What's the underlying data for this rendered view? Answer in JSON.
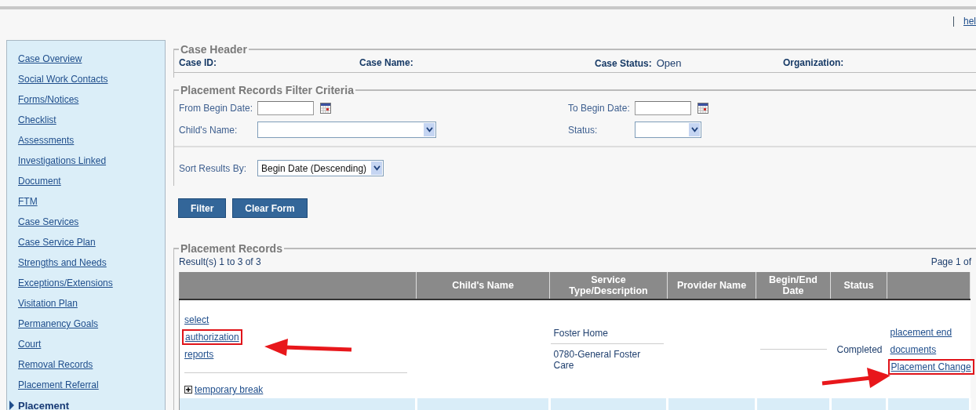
{
  "top_links": [
    {
      "label": "hel"
    }
  ],
  "sidebar": {
    "items": [
      {
        "label": "Case Overview",
        "selected": false
      },
      {
        "label": "Social Work Contacts",
        "selected": false
      },
      {
        "label": "Forms/Notices",
        "selected": false
      },
      {
        "label": "Checklist",
        "selected": false
      },
      {
        "label": "Assessments",
        "selected": false
      },
      {
        "label": "Investigations Linked",
        "selected": false
      },
      {
        "label": "Document",
        "selected": false
      },
      {
        "label": "FTM",
        "selected": false
      },
      {
        "label": "Case Services",
        "selected": false
      },
      {
        "label": "Case Service Plan",
        "selected": false
      },
      {
        "label": "Strengths and Needs",
        "selected": false
      },
      {
        "label": "Exceptions/Extensions",
        "selected": false
      },
      {
        "label": "Visitation Plan",
        "selected": false
      },
      {
        "label": "Permanency Goals",
        "selected": false
      },
      {
        "label": "Court",
        "selected": false
      },
      {
        "label": "Removal Records",
        "selected": false
      },
      {
        "label": "Placement Referral",
        "selected": false
      },
      {
        "label": "Placement",
        "selected": true
      }
    ]
  },
  "case_header": {
    "title": "Case Header",
    "fields": [
      {
        "label": "Case ID:"
      },
      {
        "label": "Case Name:"
      },
      {
        "label": "Case Status:",
        "value": "Open"
      },
      {
        "label": "Organization:"
      }
    ]
  },
  "filter": {
    "title": "Placement Records Filter Criteria",
    "from_begin_date": {
      "label": "From Begin Date:"
    },
    "to_begin_date": {
      "label": "To Begin Date:"
    },
    "childs_name": {
      "label": "Child's Name:"
    },
    "status": {
      "label": "Status:"
    },
    "sort": {
      "label": "Sort Results By:",
      "value": "Begin Date (Descending)"
    },
    "buttons": [
      "Filter",
      "Clear Form"
    ]
  },
  "records": {
    "title": "Placement Records",
    "result_text": "Result(s) 1 to 3 of 3",
    "page_text": "Page 1 of",
    "columns": [
      {},
      {
        "label": "Child's Name"
      },
      {
        "label": "Service Type/Description"
      },
      {
        "label": "Provider Name"
      },
      {
        "label": "Begin/End Date"
      },
      {
        "label": "Status"
      },
      {}
    ],
    "rows": [
      {
        "actions": [
          {
            "label": "select",
            "highlighted": false
          },
          {
            "label": "authorization",
            "highlighted": true
          },
          {
            "label": "reports",
            "highlighted": false
          }
        ],
        "expand_link": "temporary break",
        "service": [
          "Foster Home",
          "0780-General Foster Care"
        ],
        "status": "Completed",
        "links": [
          {
            "label": "placement end",
            "highlighted": false
          },
          {
            "label": "documents",
            "highlighted": false
          },
          {
            "label": "Placement Change",
            "highlighted": true
          }
        ]
      }
    ]
  }
}
